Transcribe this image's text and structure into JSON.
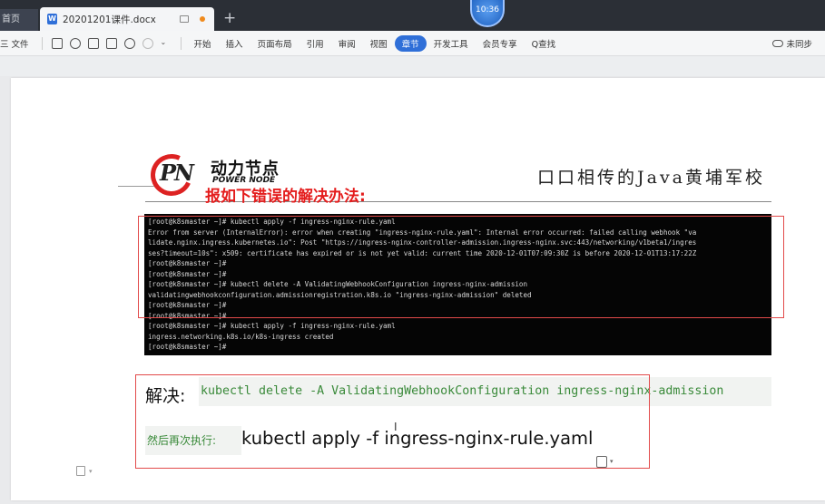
{
  "titlebar": {
    "home_tab": "首页",
    "doc_tab": "20201201课件.docx",
    "doc_icon": "W",
    "new_tab": "+",
    "clock": "10:36"
  },
  "toolbar": {
    "file_menu": "三 文件",
    "menu_items": [
      "开始",
      "插入",
      "页面布局",
      "引用",
      "审阅",
      "视图",
      "章节",
      "开发工具",
      "会员专享"
    ],
    "active_item": "章节",
    "search": "Q查找",
    "sync": "未同步"
  },
  "slide": {
    "logo_cn": "动力节点",
    "logo_en": "POWER NODE",
    "logo_mark": "PN",
    "slogan": "口口相传的Java黄埔军校",
    "title": "报如下错误的解决办法:"
  },
  "terminal": {
    "lines": [
      "[root@k8smaster ~]# kubectl apply -f ingress-nginx-rule.yaml",
      "Error from server (InternalError): error when creating \"ingress-nginx-rule.yaml\": Internal error occurred: failed calling webhook \"va",
      "lidate.nginx.ingress.kubernetes.io\": Post \"https://ingress-nginx-controller-admission.ingress-nginx.svc:443/networking/v1beta1/ingres",
      "ses?timeout=10s\": x509: certificate has expired or is not yet valid: current time 2020-12-01T07:09:30Z is before 2020-12-01T13:17:22Z",
      "[root@k8smaster ~]#",
      "[root@k8smaster ~]#",
      "[root@k8smaster ~]# kubectl delete -A ValidatingWebhookConfiguration ingress-nginx-admission",
      "validatingwebhookconfiguration.admissionregistration.k8s.io \"ingress-nginx-admission\" deleted",
      "[root@k8smaster ~]#",
      "[root@k8smaster ~]#",
      "[root@k8smaster ~]# kubectl apply -f ingress-nginx-rule.yaml",
      "ingress.networking.k8s.io/k8s-ingress created",
      "[root@k8smaster ~]#"
    ]
  },
  "solution": {
    "label": "解决:",
    "code": "kubectl delete -A ValidatingWebhookConfiguration ingress-nginx-admission",
    "then_label": "然后再次执行:",
    "then_cmd": "kubectl apply -f ingress-nginx-rule.yaml"
  },
  "colors": {
    "accent": "#2f6fd8",
    "title_red": "#e41c1c",
    "code_green": "#3a8a3a",
    "terminal_bg": "#050505"
  }
}
